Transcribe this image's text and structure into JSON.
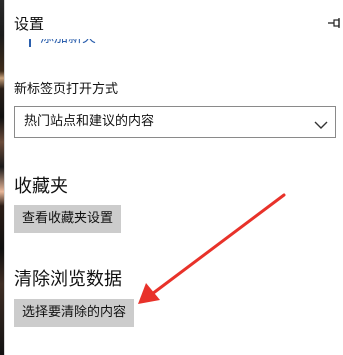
{
  "panel": {
    "title": "设置",
    "pin_icon": "pin-icon",
    "clipped_link": "添加新夹"
  },
  "new_tab": {
    "label": "新标签页打开方式",
    "selected_value": "热门站点和建议的内容"
  },
  "favorites": {
    "heading": "收藏夹",
    "button_label": "查看收藏夹设置"
  },
  "clear_data": {
    "heading": "清除浏览数据",
    "button_label": "选择要清除的内容"
  },
  "colors": {
    "button_bg": "#cccccc",
    "link_blue": "#2b5fad",
    "arrow_red": "#e8322a"
  }
}
